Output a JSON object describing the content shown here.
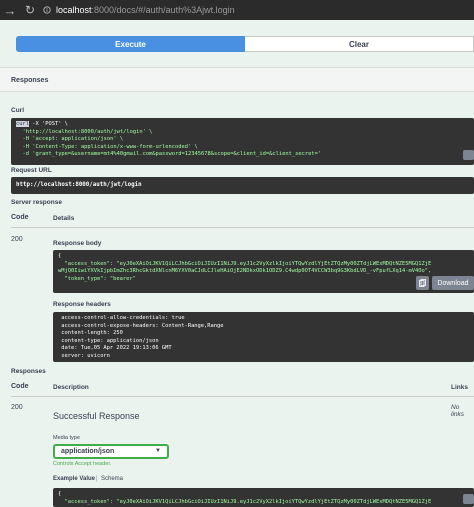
{
  "browser": {
    "url_host": "localhost",
    "url_rest": ":8000/docs/#/auth/auth%3Ajwt.login"
  },
  "actions": {
    "execute_label": "Execute",
    "clear_label": "Clear"
  },
  "responses_heading": "Responses",
  "curl": {
    "label": "Curl",
    "line1_prefix": "curl",
    "line1_rest": " -X 'POST' \\",
    "line2": "  'http://localhost:8000/auth/jwt/login' \\",
    "line3": "  -H 'accept: application/json' \\",
    "line4": "  -H 'Content-Type: application/x-www-form-urlencoded' \\",
    "line5": "  -d 'grant_type=&username=mt4%40gmail.com&password=12345678&scope=&client_id=&client_secret='"
  },
  "request_url": {
    "label": "Request URL",
    "value": "http://localhost:8000/auth/jwt/login"
  },
  "server_response": {
    "label": "Server response",
    "code_header": "Code",
    "details_header": "Details",
    "code": "200",
    "body_label": "Response body",
    "body_line1": "{",
    "body_line2": "  \"access_token\": \"eyJ0eXAiOiJKV1QiLCJhbGciOiJIUzI1NiJ9.eyJ1c2VyXzlkIjoiYTQwYzdlYjEtZTQzMy00ZTdjLWExMDQtNZE5MGQ1ZjE",
    "body_line3": "wMjQ0IiwiYXVkIjpbImZhc3RhcGktdXNlcnM6YXV0aCJdLCJleHAiOjE2NDkxODk1ODZ9.C4wdp0OT4VCCW3bq9G3KbdLVD_-vFpufLXq14-mV4Oo\",",
    "body_line4": "  \"token_type\": \"bearer\"",
    "download_label": "Download",
    "headers_label": "Response headers",
    "header_line1": " access-control-allow-credentials: true",
    "header_line2": " access-control-expose-headers: Content-Range,Range",
    "header_line3": " content-length: 250",
    "header_line4": " content-type: application/json",
    "header_line5": " date: Tue,05 Apr 2022 19:13:06 GMT",
    "header_line6": " server: uvicorn"
  },
  "responses_section": {
    "label": "Responses",
    "code_header": "Code",
    "description_header": "Description",
    "links_header": "Links",
    "code": "200",
    "description": "Successful Response",
    "links_value": "No links",
    "media_type_label": "Media type",
    "media_type_value": "application/json",
    "accept_note": "Controls Accept header.",
    "example_value_tab": "Example Value",
    "schema_tab": "Schema",
    "example_line1": "{",
    "example_line2": "  \"access_token\": \"eyJ0eXAiOiJKV1QiLCJhbGciOiJIUzI1NiJ9.eyJ1c2VyX2lkIjoiYTQwYzdlYjEtZTQzMy00ZTdjLWExMDQtNZE5MGQ1ZjE"
  },
  "colors": {
    "execute_blue": "#4990e2",
    "panel_dark": "#333333",
    "success_green": "#41ad49",
    "body_tint": "#ebf3ef"
  }
}
